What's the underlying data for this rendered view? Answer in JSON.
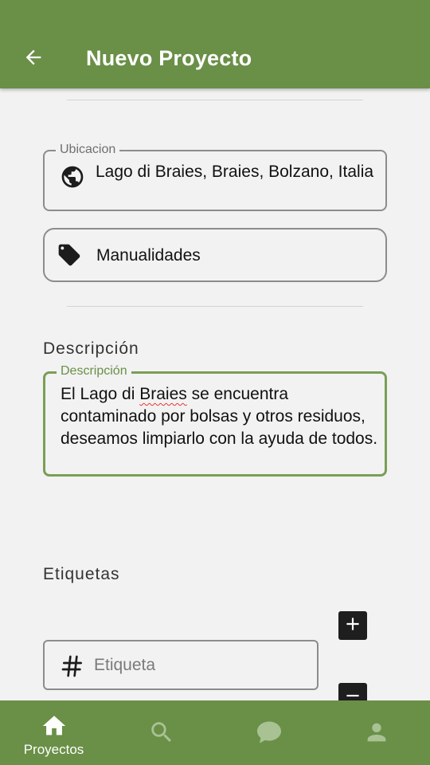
{
  "header": {
    "back_icon": "arrow-left-icon",
    "title": "Nuevo Proyecto"
  },
  "location": {
    "label": "Ubicacion",
    "value": "Lago di Braies, Braies, Bolzano, Italia",
    "icon": "globe-icon"
  },
  "category": {
    "value": "Manualidades",
    "icon": "tag-icon"
  },
  "description": {
    "section_title": "Descripción",
    "field_label": "Descripción",
    "text_before": "El Lago di ",
    "text_misspelled": "Braies",
    "text_after": " se encuentra contaminado por bolsas y otros residuos, deseamos limpiarlo con la ayuda de todos."
  },
  "tags": {
    "section_title": "Etiquetas",
    "placeholder": "Etiqueta",
    "icon": "hash-icon",
    "add_icon": "plus-icon",
    "remove_icon": "minus-icon"
  },
  "bottom_nav": {
    "items": [
      {
        "label": "Proyectos",
        "icon": "home-icon",
        "active": true
      },
      {
        "label": "",
        "icon": "search-icon",
        "active": false
      },
      {
        "label": "",
        "icon": "chat-icon",
        "active": false
      },
      {
        "label": "",
        "icon": "person-icon",
        "active": false
      }
    ]
  },
  "colors": {
    "primary": "#6a8f47",
    "background": "#f2f2f2",
    "inactive_nav_icon": "#a9c294",
    "focused_border": "#7a9e57"
  }
}
